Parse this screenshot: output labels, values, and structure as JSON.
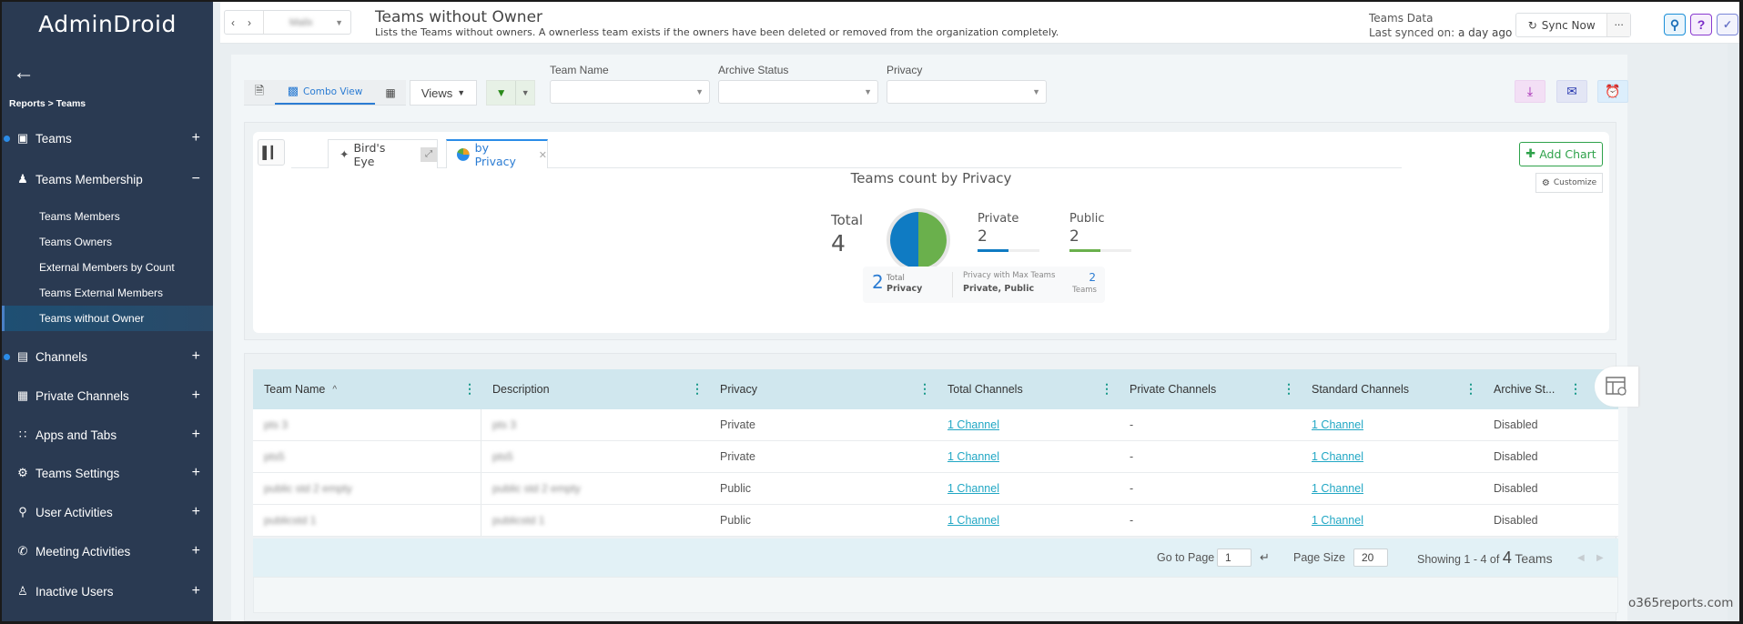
{
  "app": {
    "name": "AdminDroid"
  },
  "sidebar": {
    "breadcrumb": "Reports > Teams",
    "items": [
      {
        "label": "Teams",
        "icon": "teams-icon",
        "toggle": "+",
        "dot": true
      },
      {
        "label": "Teams Membership",
        "icon": "people-group-icon",
        "toggle": "−",
        "dot": false
      },
      {
        "label": "Channels",
        "icon": "list-icon",
        "toggle": "+",
        "dot": true
      },
      {
        "label": "Private Channels",
        "icon": "private-report-icon",
        "toggle": "+",
        "dot": false
      },
      {
        "label": "Apps and Tabs",
        "icon": "grid-icon",
        "toggle": "+",
        "dot": false
      },
      {
        "label": "Teams Settings",
        "icon": "gear-icon",
        "toggle": "+",
        "dot": false
      },
      {
        "label": "User Activities",
        "icon": "fingerprint-search-icon",
        "toggle": "+",
        "dot": false
      },
      {
        "label": "Meeting Activities",
        "icon": "phone-call-icon",
        "toggle": "+",
        "dot": false
      },
      {
        "label": "Inactive Users",
        "icon": "user-x-icon",
        "toggle": "+",
        "dot": false
      }
    ],
    "subitems": [
      {
        "label": "Teams Members"
      },
      {
        "label": "Teams Owners"
      },
      {
        "label": "External Members by Count"
      },
      {
        "label": "Teams External Members"
      },
      {
        "label": "Teams without Owner",
        "active": true
      }
    ]
  },
  "header": {
    "view_selector_value": "Mailx",
    "title": "Teams without Owner",
    "description": "Lists the Teams without owners. A ownerless team exists if the owners have been deleted or removed from the organization completely.",
    "data_source": "Teams Data",
    "last_synced_label": "Last synced on:",
    "last_synced_value": "a day ago",
    "sync_label": "Sync Now",
    "more_label": "···"
  },
  "toolbar": {
    "combo_view_label": "Combo View",
    "views_label": "Views"
  },
  "filters": [
    {
      "label": "Team Name",
      "value": ""
    },
    {
      "label": "Archive Status",
      "value": ""
    },
    {
      "label": "Privacy",
      "value": ""
    }
  ],
  "chart_panel": {
    "tabs": [
      {
        "label": "Bird's Eye"
      },
      {
        "label": "by Privacy",
        "active": true
      }
    ],
    "add_chart_label": "Add Chart",
    "customize_label": "Customize",
    "summary": {
      "total_count": "2",
      "total_label_top": "Total",
      "total_label_bottom": "Privacy",
      "max_label": "Privacy with Max Teams",
      "max_value": "Private, Public",
      "max_count": "2",
      "max_unit": "Teams"
    }
  },
  "chart_data": {
    "type": "pie",
    "title": "Teams count by Privacy",
    "total_label": "Total",
    "total": 4,
    "categories": [
      "Private",
      "Public"
    ],
    "values": [
      2,
      2
    ],
    "colors": [
      "#0f7bc3",
      "#6ab04c"
    ]
  },
  "table": {
    "columns": [
      "Team Name",
      "Description",
      "Privacy",
      "Total Channels",
      "Private Channels",
      "Standard Channels",
      "Archive St..."
    ],
    "sort_indicator": "^",
    "rows": [
      [
        "pts 3",
        "pts 3",
        "Private",
        "1 Channel",
        "-",
        "1 Channel",
        "Disabled"
      ],
      [
        "pts5",
        "pts5",
        "Private",
        "1 Channel",
        "-",
        "1 Channel",
        "Disabled"
      ],
      [
        "public std 2 empty",
        "public std 2 empty",
        "Public",
        "1 Channel",
        "-",
        "1 Channel",
        "Disabled"
      ],
      [
        "publicstd 1",
        "publicstd 1",
        "Public",
        "1 Channel",
        "-",
        "1 Channel",
        "Disabled"
      ]
    ]
  },
  "pager": {
    "goto_label": "Go to Page",
    "page_value": "1",
    "page_size_label": "Page Size",
    "page_size_value": "20",
    "showing_prefix": "Showing 1 - 4 of",
    "showing_total": "4",
    "showing_suffix": "Teams"
  },
  "watermark": "o365reports.com"
}
